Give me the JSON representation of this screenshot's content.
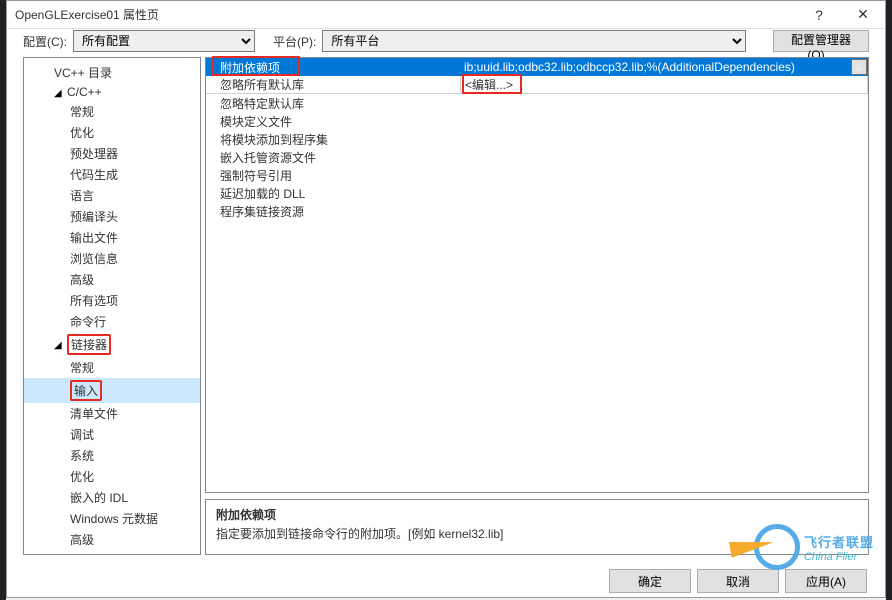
{
  "title": "OpenGLExercise01 属性页",
  "toprow": {
    "config_label": "配置(C):",
    "config_value": "所有配置",
    "platform_label": "平台(P):",
    "platform_value": "所有平台",
    "manager_btn": "配置管理器(O)..."
  },
  "tree": {
    "vc_dirs": "VC++ 目录",
    "cpp": "C/C++",
    "cpp_items": [
      "常规",
      "优化",
      "预处理器",
      "代码生成",
      "语言",
      "预编译头",
      "输出文件",
      "浏览信息",
      "高级",
      "所有选项",
      "命令行"
    ],
    "linker": "链接器",
    "linker_items": [
      "常规",
      "输入",
      "清单文件",
      "调试",
      "系统",
      "优化",
      "嵌入的 IDL",
      "Windows 元数据",
      "高级"
    ]
  },
  "grid": {
    "rows": [
      {
        "key": "附加依赖项",
        "val": "ib;uuid.lib;odbc32.lib;odbccp32.lib;%(AdditionalDependencies)"
      },
      {
        "key": "忽略所有默认库",
        "val": "<编辑...>"
      },
      {
        "key": "忽略特定默认库",
        "val": ""
      },
      {
        "key": "模块定义文件",
        "val": ""
      },
      {
        "key": "将模块添加到程序集",
        "val": ""
      },
      {
        "key": "嵌入托管资源文件",
        "val": ""
      },
      {
        "key": "强制符号引用",
        "val": ""
      },
      {
        "key": "延迟加载的 DLL",
        "val": ""
      },
      {
        "key": "程序集链接资源",
        "val": ""
      }
    ]
  },
  "description": {
    "title": "附加依赖项",
    "text": "指定要添加到链接命令行的附加项。[例如 kernel32.lib]"
  },
  "footer": {
    "ok": "确定",
    "cancel": "取消",
    "apply": "应用(A)"
  },
  "watermark": {
    "line1": "飞行者联盟",
    "line2": "China Flier"
  }
}
